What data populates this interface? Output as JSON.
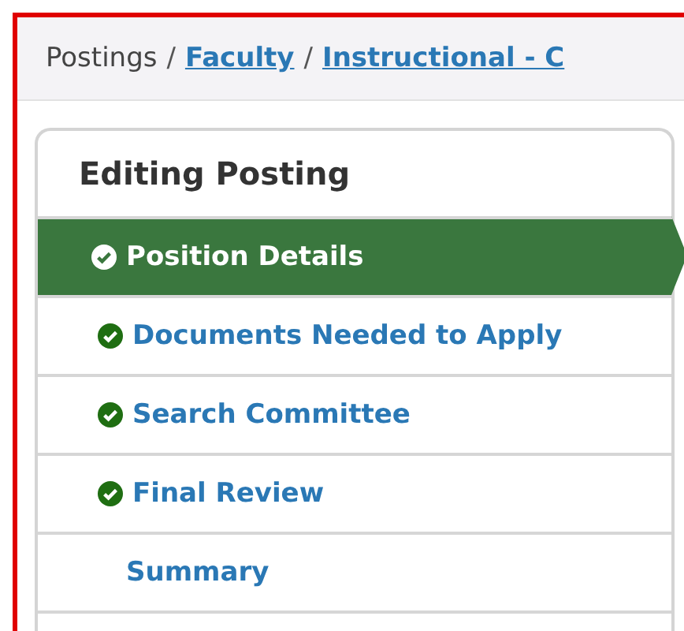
{
  "breadcrumb": [
    {
      "label": "Postings",
      "kind": "text"
    },
    {
      "label": "/",
      "kind": "separator"
    },
    {
      "label": "Faculty",
      "kind": "link"
    },
    {
      "label": "/",
      "kind": "separator"
    },
    {
      "label": "Instructional - C",
      "kind": "link"
    }
  ],
  "panel": {
    "title": "Editing Posting",
    "items": [
      {
        "label": "Position Details",
        "completed": true,
        "selected": true
      },
      {
        "label": "Documents Needed to Apply",
        "completed": true,
        "selected": false
      },
      {
        "label": "Search Committee",
        "completed": true,
        "selected": false
      },
      {
        "label": "Final Review",
        "completed": true,
        "selected": false
      },
      {
        "label": "Summary",
        "completed": false,
        "selected": false
      }
    ]
  }
}
